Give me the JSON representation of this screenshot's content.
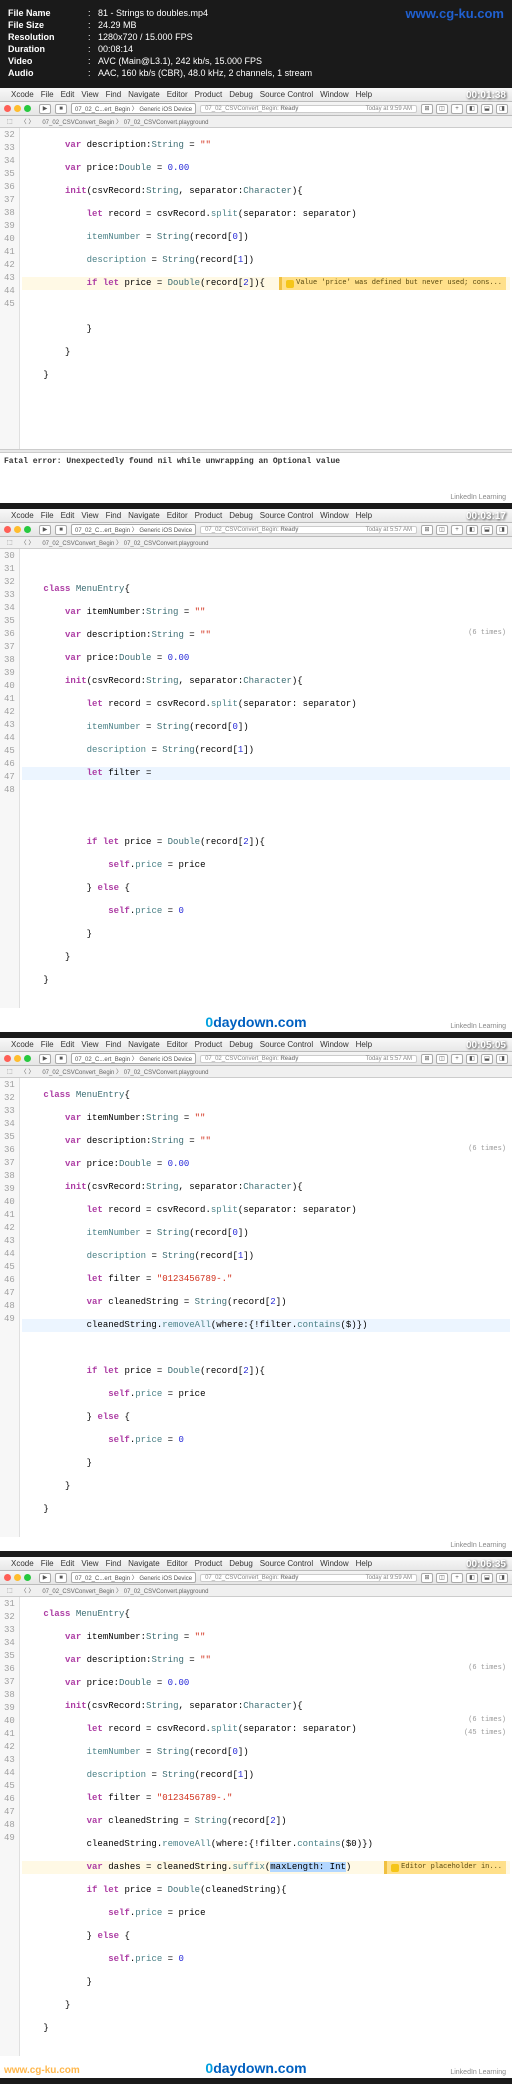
{
  "header": {
    "file_name_label": "File Name",
    "file_name": "81 - Strings to doubles.mp4",
    "file_size_label": "File Size",
    "file_size": "24.29 MB",
    "resolution_label": "Resolution",
    "resolution": "1280x720 / 15.000 FPS",
    "duration_label": "Duration",
    "duration": "00:08:14",
    "video_label": "Video",
    "video": "AVC (Main@L3.1), 242 kb/s, 15.000 FPS",
    "audio_label": "Audio",
    "audio": "AAC, 160 kb/s (CBR), 48.0 kHz, 2 channels, 1 stream",
    "watermark": "www.cg-ku.com"
  },
  "menubar": {
    "apple": "",
    "items": [
      "Xcode",
      "File",
      "Edit",
      "View",
      "Find",
      "Navigate",
      "Editor",
      "Product",
      "Debug",
      "Source Control",
      "Window",
      "Help"
    ]
  },
  "status": {
    "left": "07_02_CSVConvert_Begin:",
    "ready": "Ready",
    "time": "Today at 9:59 AM"
  },
  "scheme": {
    "target": "07_02_C...ert_Begin",
    "device": "Generic iOS Device"
  },
  "breadcrumb": "07_02_CSVConvert_Begin 〉 07_02_CSVConvert.playground",
  "panels": {
    "p1": {
      "timestamp": "00:01:38",
      "lines_start": 32,
      "warning": "Value 'price' was defined but never used; cons...",
      "console": "Fatal error: Unexpectedly found nil while unwrapping an Optional value"
    },
    "p2": {
      "timestamp": "00:03:17",
      "lines_start": 30,
      "sidenote": "(6 times)"
    },
    "p3": {
      "timestamp": "00:05:05",
      "lines_start": 31,
      "sidenote": "(6 times)"
    },
    "p4": {
      "timestamp": "00:06:35",
      "lines_start": 31,
      "sidenotes": [
        "(6 times)",
        "(6 times)",
        "(45 times)"
      ],
      "warning": "Editor placeholder in...",
      "selected": "maxLength: Int"
    }
  },
  "code": {
    "class_decl": "class MenuEntry{",
    "var_desc": "    var description:String = \"\"",
    "var_item": "    var itemNumber:String = \"\"",
    "var_price": "    var price:Double = 0.00",
    "init_sig": "    init(csvRecord:String, separator:Character){",
    "let_record": "        let record = csvRecord.split(separator: separator)",
    "item_assign": "        itemNumber = String(record[0])",
    "desc_assign": "        description = String(record[1])",
    "if_let_price": "        if let price = Double(record[2]){",
    "let_filter_empty": "        let filter =",
    "let_filter": "        let filter = \"0123456789-.\"",
    "var_cleaned": "        var cleanedString = String(record[2])",
    "remove_all": "        cleanedString.removeAll(where:{!filter.contains($)})",
    "remove_all_0": "        cleanedString.removeAll(where:{!filter.contains($0)})",
    "var_dashes": "        var dashes = cleanedString.suffix(",
    "if_let_cleaned": "        if let price = Double(cleanedString){",
    "self_price": "            self.price = price",
    "else_open": "        } else {",
    "self_price_0": "            self.price = 0",
    "close_brace1": "        }",
    "close_brace2": "    }",
    "close_brace3": "}",
    "empty": ""
  },
  "watermarks": {
    "daydown": "0daydown.com",
    "cgku": "www.cg-ku.com",
    "linkedin": "LinkedIn Learning"
  }
}
